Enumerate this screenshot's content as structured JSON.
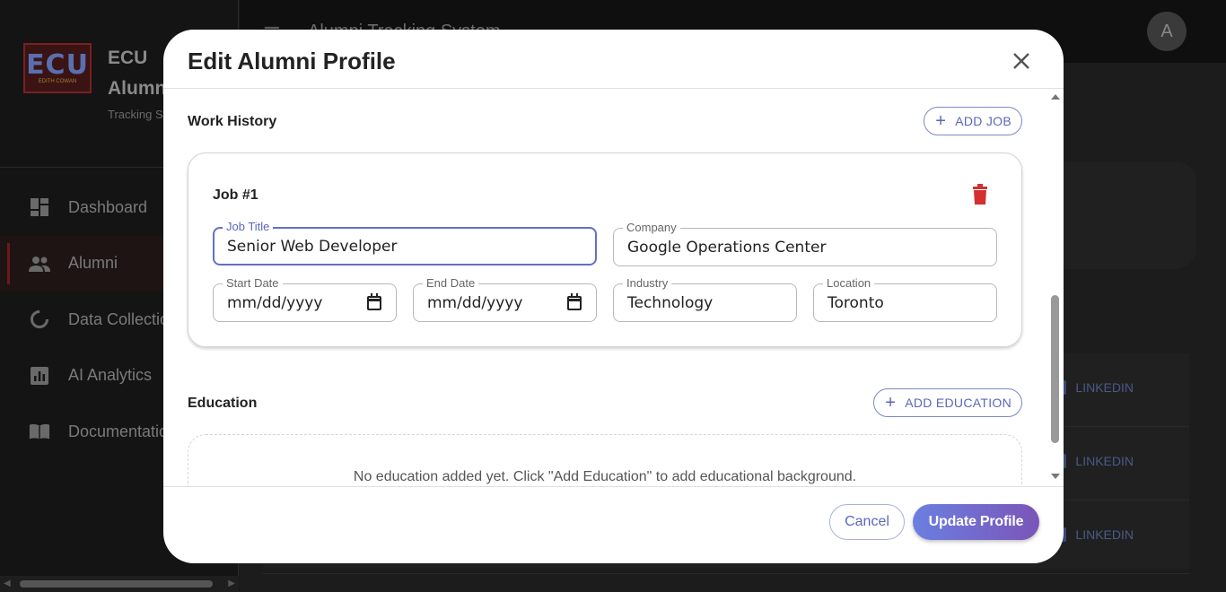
{
  "app": {
    "brand_logo_text": "ECU",
    "brand_logo_sub": "EDITH COWAN",
    "brand_name_line1": "ECU",
    "brand_name_line2": "Alumni",
    "brand_tagline": "Tracking System",
    "topbar_title": "Alumni Tracking System",
    "avatar_initial": "A",
    "nav": [
      {
        "label": "Dashboard",
        "icon": "dashboard-icon"
      },
      {
        "label": "Alumni",
        "icon": "people-icon",
        "active": true
      },
      {
        "label": "Data Collection",
        "icon": "data-collection-icon"
      },
      {
        "label": "AI Analytics",
        "icon": "analytics-icon"
      },
      {
        "label": "Documentation",
        "icon": "book-icon"
      }
    ],
    "rows": [
      {
        "link_label": "LINKEDIN"
      },
      {
        "link_label": "LINKEDIN"
      },
      {
        "link_label": "LINKEDIN"
      }
    ]
  },
  "modal": {
    "title": "Edit Alumni Profile",
    "work_history": {
      "title": "Work History",
      "add_label": "ADD JOB",
      "jobs": [
        {
          "heading": "Job #1",
          "job_title_label": "Job Title",
          "job_title_value": "Senior Web Developer",
          "company_label": "Company",
          "company_value": "Google Operations Center",
          "start_date_label": "Start Date",
          "start_date_value": "mm/dd/yyyy",
          "end_date_label": "End Date",
          "end_date_value": "mm/dd/yyyy",
          "industry_label": "Industry",
          "industry_value": "Technology",
          "location_label": "Location",
          "location_value": "Toronto"
        }
      ]
    },
    "education": {
      "title": "Education",
      "add_label": "ADD EDUCATION",
      "empty_message": "No education added yet. Click \"Add Education\" to add educational background."
    },
    "footer": {
      "cancel_label": "Cancel",
      "update_label": "Update Profile"
    }
  },
  "colors": {
    "accent": "#5c67b8",
    "delete": "#d32f2f",
    "update_gradient_start": "#6b7fe0",
    "update_gradient_end": "#7b55b8"
  }
}
